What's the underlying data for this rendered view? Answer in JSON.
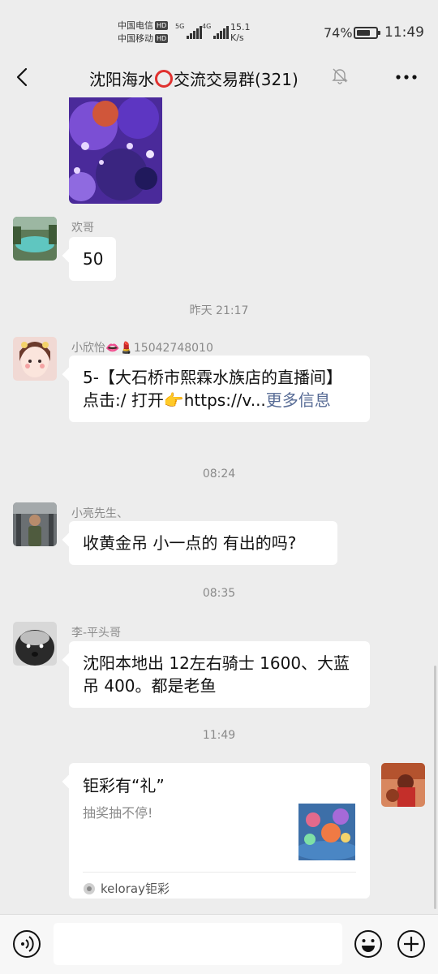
{
  "status_bar": {
    "carrier_1": "中国电信",
    "carrier_2": "中国移动",
    "hd": "HD",
    "net_1": "5G",
    "net_2": "4G",
    "speed_value": "15.1",
    "speed_unit": "K/s",
    "battery": "74%",
    "battery_level": 0.74,
    "time": "11:49"
  },
  "header": {
    "title_part1": "沈阳海水",
    "title_part2": "交流交易群(321)",
    "back_icon": "chevron-left-icon",
    "mute_icon": "bell-off-icon",
    "more_icon": "ellipsis-icon"
  },
  "messages": [
    {
      "type": "image",
      "desc": "coral-photo"
    },
    {
      "sender": "欢哥",
      "text": "50"
    },
    {
      "timestamp": "昨天 21:17"
    },
    {
      "sender_name": "小欣怡",
      "sender_emoji": "👄💄",
      "sender_phone": "15042748010",
      "text": "5-【大石桥市熙霖水族店的直播间】 点击:/ 打开👉https://v...",
      "more_label": "更多信息"
    },
    {
      "timestamp": "08:24"
    },
    {
      "sender": "小亮先生、",
      "text": "收黄金吊 小一点的 有出的吗?"
    },
    {
      "timestamp": "08:35"
    },
    {
      "sender": "李-平头哥",
      "text": "沈阳本地出 12左右骑士 1600、大蓝吊 400。都是老鱼"
    },
    {
      "timestamp": "11:49"
    },
    {
      "type": "card",
      "title": "钜彩有“礼”",
      "subtitle": "抽奖抽不停!",
      "source": "keloray钜彩"
    }
  ],
  "input_bar": {
    "voice_icon": "voice-icon",
    "emoji_icon": "emoji-smile-icon",
    "plus_icon": "plus-circle-icon"
  },
  "colors": {
    "background": "#ededed",
    "bubble": "#ffffff",
    "link": "#576b95",
    "ring": "#e0312f"
  }
}
